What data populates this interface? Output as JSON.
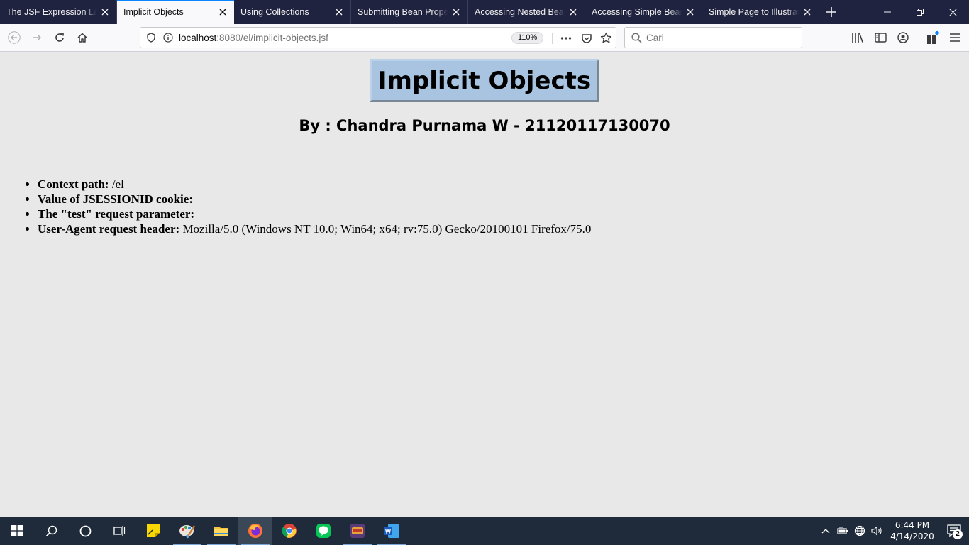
{
  "browser": {
    "tabs": [
      {
        "title": "The JSF Expression Lang",
        "active": false
      },
      {
        "title": "Implicit Objects",
        "active": true
      },
      {
        "title": "Using Collections",
        "active": false
      },
      {
        "title": "Submitting Bean Proper",
        "active": false
      },
      {
        "title": "Accessing Nested Bean",
        "active": false
      },
      {
        "title": "Accessing Simple Bean",
        "active": false
      },
      {
        "title": "Simple Page to Illustrate",
        "active": false
      }
    ],
    "url_host": "localhost",
    "url_rest": ":8080/el/implicit-objects.jsf",
    "zoom": "110%",
    "search_placeholder": "Cari"
  },
  "page": {
    "heading": "Implicit Objects",
    "author": "By : Chandra Purnama W - 21120117130070",
    "items": [
      {
        "label": "Context path:",
        "value": " /el"
      },
      {
        "label": "Value of JSESSIONID cookie:",
        "value": ""
      },
      {
        "label": "The \"test\" request parameter:",
        "value": ""
      },
      {
        "label": "User-Agent request header:",
        "value": " Mozilla/5.0 (Windows NT 10.0; Win64; x64; rv:75.0) Gecko/20100101 Firefox/75.0"
      }
    ]
  },
  "taskbar": {
    "time": "6:44 PM",
    "date": "4/14/2020",
    "notification_count": "2",
    "apps": [
      "start-icon",
      "search-icon",
      "cortana-icon",
      "task-view-icon",
      "sticky-notes-icon",
      "paint-icon",
      "file-explorer-icon",
      "firefox-icon",
      "chrome-icon",
      "line-icon",
      "game-icon",
      "word-icon"
    ]
  },
  "colors": {
    "tabbar": "#202340",
    "accent": "#0a84ff",
    "heading_bg": "#a9c4e0",
    "page_bg": "#e8e8e8",
    "taskbar": "#1f2b3a"
  }
}
